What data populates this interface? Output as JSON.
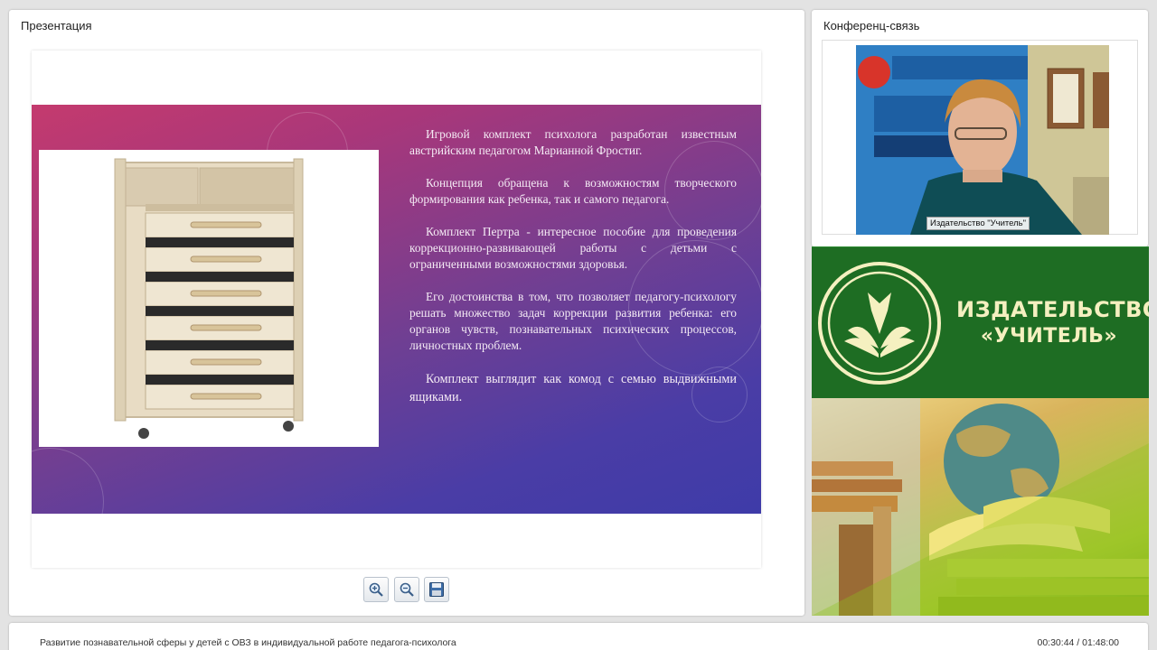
{
  "presentation": {
    "title": "Презентация",
    "slide": {
      "paragraphs": [
        "Игровой комплект психолога разработан известным австрийским педагогом Марианной Фростиг.",
        "Концепция обращена к возможностям творческого формирования как ребенка, так и самого педагога.",
        "Комплект Пертра - интересное пособие для проведения коррекционно-развивающей работы с детьми с ограниченными возможностями здоровья.",
        "Его достоинства в том, что позволяет педагогу-психологу решать множество задач коррекции развития ребенка: его органов чувств, познавательных психических процессов, личностных проблем.",
        "Комплект выглядит как комод с семью выдвижными ящиками."
      ]
    },
    "toolbar": {
      "zoom_in_icon": "zoom-in-icon",
      "zoom_out_icon": "zoom-out-icon",
      "save_icon": "floppy-disk-icon"
    }
  },
  "conference": {
    "title": "Конференц-связь",
    "participant_label": "Издательство \"Учитель\""
  },
  "banner": {
    "line1": "ИЗДАТЕЛЬСТВО",
    "line2": "«УЧИТЕЛЬ»"
  },
  "footer": {
    "lecture_title": "Развитие познавательной сферы у детей с ОВЗ в индивидуальной работе педагога-психолога",
    "time": "00:30:44 / 01:48:00"
  },
  "colors": {
    "background": "#e3e3e3",
    "banner_green": "#1e6d23",
    "slide_pink": "#c43a6e",
    "slide_blue": "#3e3ba8"
  }
}
